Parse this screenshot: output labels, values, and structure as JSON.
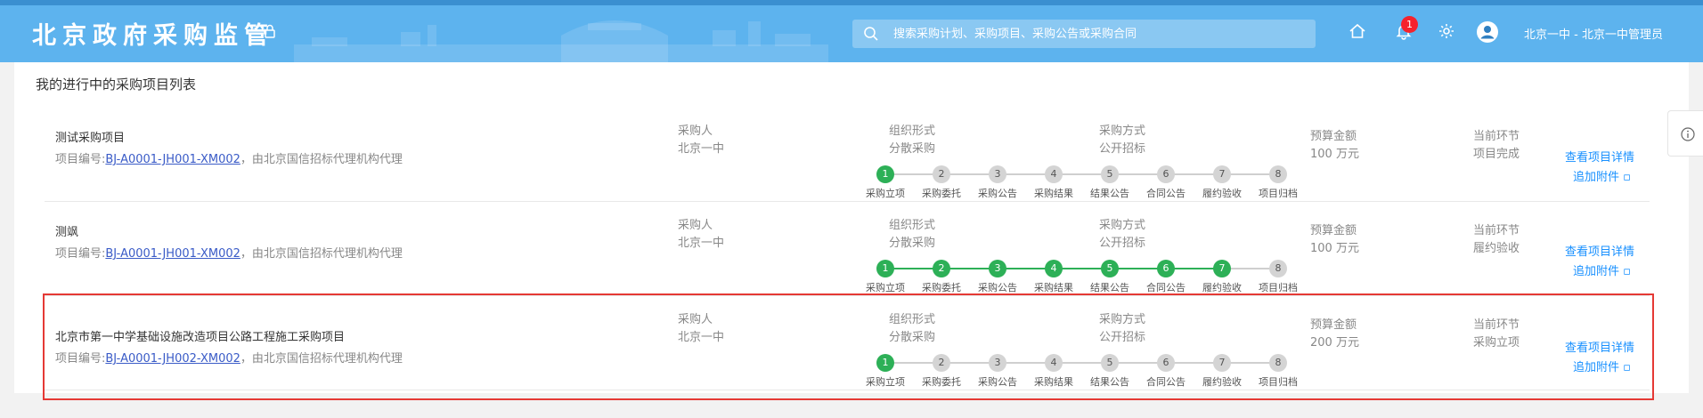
{
  "header": {
    "logo": "北京政府采购监管",
    "search_placeholder": "搜索采购计划、采购项目、采购公告或采购合同",
    "notification_count": "1",
    "user": "北京一中 - 北京一中管理员"
  },
  "page_title": "我的进行中的采购项目列表",
  "labels": {
    "purchaser": "采购人",
    "org_form": "组织形式",
    "method": "采购方式",
    "budget": "预算金额",
    "stage": "当前环节",
    "view_detail": "查看项目详情",
    "add_attachment": "追加附件 ▫"
  },
  "step_names": [
    "采购立项",
    "采购委托",
    "采购公告",
    "采购结果",
    "结果公告",
    "合同公告",
    "履约验收",
    "项目归档"
  ],
  "projects": [
    {
      "name": "测试采购项目",
      "no_prefix": "项目编号:",
      "no": "BJ-A0001-JH001-XM002",
      "agent": "，由北京国信招标代理机构代理",
      "purchaser": "北京一中",
      "org_form": "分散采购",
      "method": "公开招标",
      "budget": "100 万元",
      "stage": "项目完成",
      "steps_done": 1
    },
    {
      "name": "测飒",
      "no_prefix": "项目编号:",
      "no": "BJ-A0001-JH001-XM002",
      "agent": "，由北京国信招标代理机构代理",
      "purchaser": "北京一中",
      "org_form": "分散采购",
      "method": "公开招标",
      "budget": "100 万元",
      "stage": "履约验收",
      "steps_done": 7
    },
    {
      "name": "北京市第一中学基础设施改造项目公路工程施工采购项目",
      "no_prefix": "项目编号:",
      "no": "BJ-A0001-JH002-XM002",
      "agent": "，由北京国信招标代理机构代理",
      "purchaser": "北京一中",
      "org_form": "分散采购",
      "method": "公开招标",
      "budget": "200 万元",
      "stage": "采购立项",
      "steps_done": 1
    }
  ],
  "colors": {
    "header_bg": "#5db3ee",
    "step_done": "#2db057",
    "step_todo": "#d4d4d4",
    "link": "#1890ff",
    "highlight": "#e53935"
  }
}
